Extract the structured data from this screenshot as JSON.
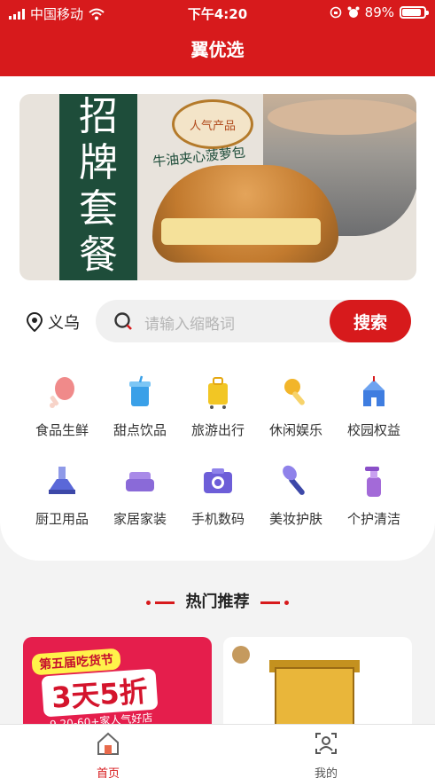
{
  "status_bar": {
    "carrier": "中国移动",
    "time": "下午4:20",
    "battery": "89%",
    "battery_level": 0.89
  },
  "header": {
    "title": "翼优选"
  },
  "banner": {
    "sign_chars": [
      "招",
      "牌",
      "套",
      "餐"
    ],
    "seal_text": "人气产品",
    "caption": "牛油夹心菠萝包"
  },
  "location": {
    "city": "义乌"
  },
  "search": {
    "placeholder": "请输入缩略词",
    "button_label": "搜索"
  },
  "categories": [
    {
      "label": "食品生鲜",
      "icon": "drumstick-icon",
      "color": "#f07a7a"
    },
    {
      "label": "甜点饮品",
      "icon": "drink-cup-icon",
      "color": "#3aa0e8"
    },
    {
      "label": "旅游出行",
      "icon": "suitcase-icon",
      "color": "#f2c624"
    },
    {
      "label": "休闲娱乐",
      "icon": "microphone-icon",
      "color": "#f2b52a"
    },
    {
      "label": "校园权益",
      "icon": "school-icon",
      "color": "#3f7de0"
    },
    {
      "label": "厨卫用品",
      "icon": "range-hood-icon",
      "color": "#5a68d8"
    },
    {
      "label": "家居家装",
      "icon": "sofa-icon",
      "color": "#8a6ad8"
    },
    {
      "label": "手机数码",
      "icon": "camera-icon",
      "color": "#6d5ed8"
    },
    {
      "label": "美妆护肤",
      "icon": "makeup-brush-icon",
      "color": "#6d5ed8"
    },
    {
      "label": "个护清洁",
      "icon": "spray-bottle-icon",
      "color": "#a36ad8"
    }
  ],
  "section": {
    "title": "热门推荐"
  },
  "products": [
    {
      "promo_top": "第五届吃货节",
      "promo_main": "3天5折",
      "promo_sub": "9.20-60+家人气好店"
    },
    {
      "name": ""
    }
  ],
  "tabbar": {
    "items": [
      {
        "label": "首页",
        "icon": "home-icon",
        "active": true
      },
      {
        "label": "我的",
        "icon": "profile-icon",
        "active": false
      }
    ]
  },
  "colors": {
    "brand_red": "#d71a1c",
    "background": "#f3f3f3"
  }
}
